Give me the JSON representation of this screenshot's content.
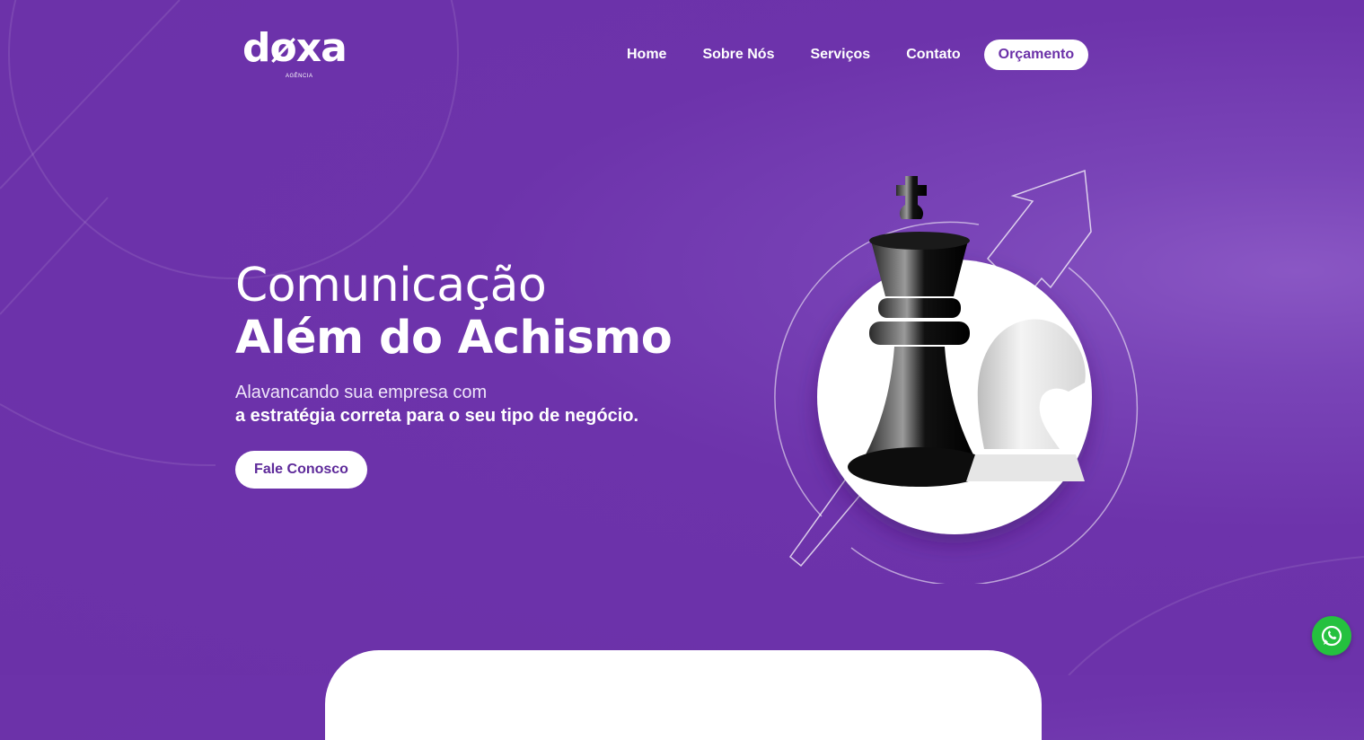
{
  "brand": {
    "logo_text": "døxa",
    "logo_subtext": "AGÊNCIA"
  },
  "nav": {
    "items": [
      {
        "label": "Home"
      },
      {
        "label": "Sobre Nós"
      },
      {
        "label": "Serviços"
      },
      {
        "label": "Contato"
      }
    ],
    "quote_button": "Orçamento"
  },
  "hero": {
    "title_light": "Comunicação",
    "title_bold": "Além do Achismo",
    "subtitle_line1": "Alavancando sua empresa com",
    "subtitle_line2": "a estratégia correta para o seu tipo de negócio.",
    "cta_label": "Fale Conosco"
  },
  "illustration": {
    "subject": "chess-king-and-knight-icon",
    "arrow": "growth-arrow-icon"
  },
  "floating": {
    "whatsapp_icon": "whatsapp-icon"
  },
  "colors": {
    "background": "#6b31a8",
    "accent": "#6b31a8",
    "button_bg": "#ffffff",
    "whatsapp": "#25c13f"
  }
}
